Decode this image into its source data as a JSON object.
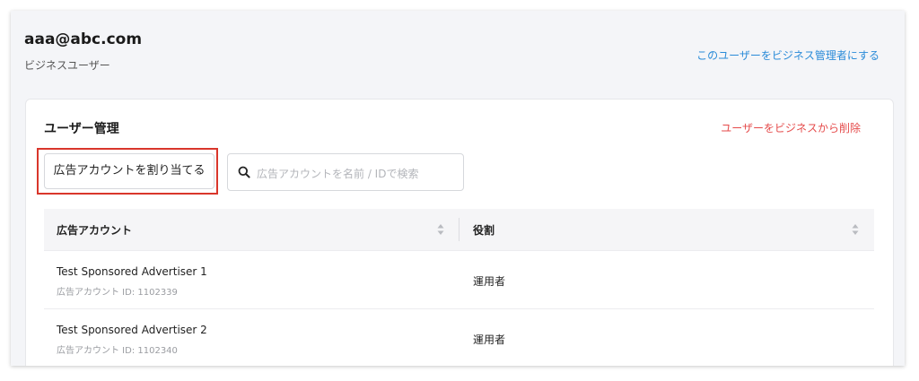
{
  "user": {
    "email": "aaa@abc.com",
    "type_label": "ビジネスユーザー",
    "make_admin_link": "このユーザーをビジネス管理者にする"
  },
  "card": {
    "title": "ユーザー管理",
    "remove_link": "ユーザーをビジネスから削除",
    "assign_button": "広告アカウントを割り当てる",
    "search_placeholder": "広告アカウントを名前 / IDで検索"
  },
  "table": {
    "columns": [
      "広告アカウント",
      "役割"
    ],
    "rows": [
      {
        "name": "Test Sponsored Advertiser 1",
        "account_id": "広告アカウント ID: 1102339",
        "role": "運用者"
      },
      {
        "name": "Test Sponsored Advertiser 2",
        "account_id": "広告アカウント ID: 1102340",
        "role": "運用者"
      }
    ]
  },
  "colors": {
    "link_blue": "#2a8bd8",
    "danger_red": "#e54b4b",
    "highlight_red": "#d9362b"
  },
  "icons": [
    "search-icon",
    "sort-icon"
  ]
}
